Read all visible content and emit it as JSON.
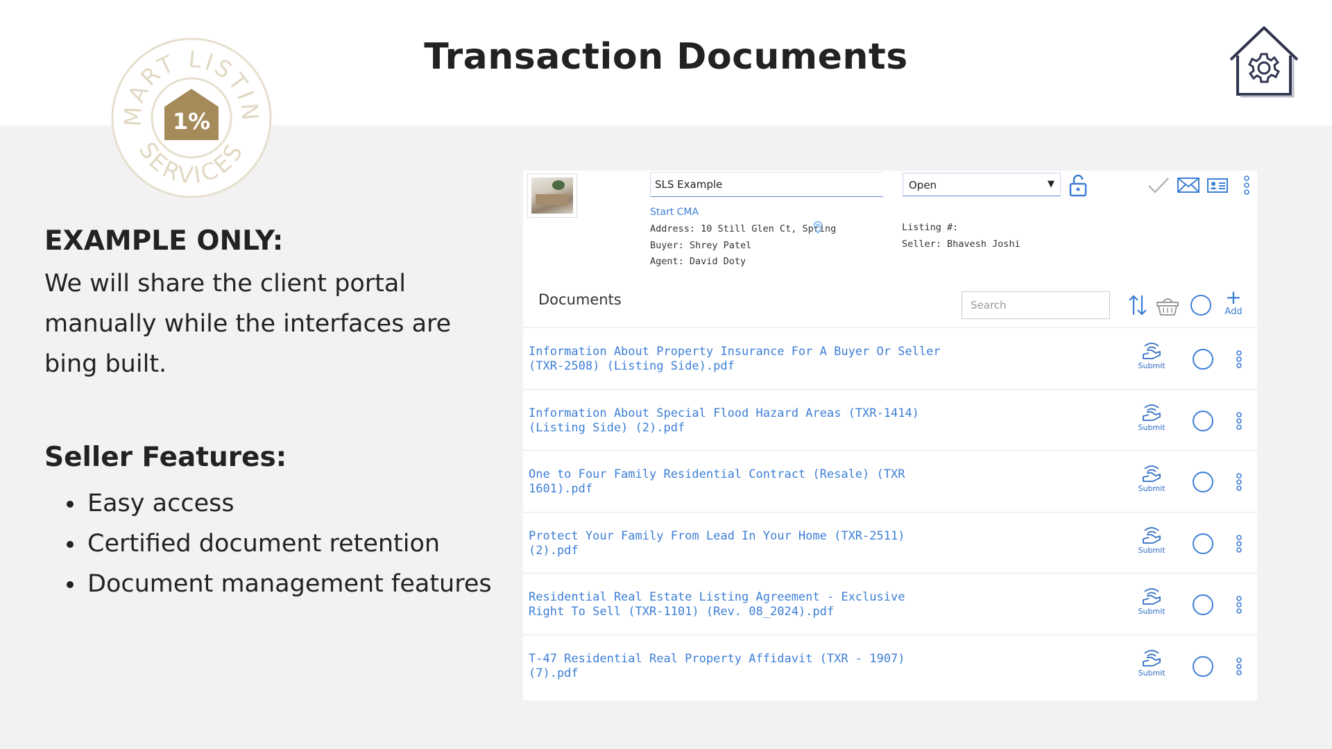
{
  "header": {
    "title": "Transaction Documents"
  },
  "logo": {
    "top_text": "SMART LISTING",
    "bottom_text": "SERVICES",
    "badge": "1%",
    "ring_color": "#e6dfcd",
    "badge_color": "#a58a5a"
  },
  "settings_icon": "house-gear-icon",
  "left": {
    "example_heading": "EXAMPLE ONLY:",
    "example_body": "We will share the client portal manually while the interfaces are bing built.",
    "features_heading": "Seller Features:",
    "features": [
      "Easy access",
      "Certified document retention",
      "Document management features"
    ]
  },
  "transaction": {
    "name_value": "SLS Example",
    "status_value": "Open",
    "start_cma": "Start CMA",
    "address": "Address: 10 Still Glen Ct, Spring",
    "buyer": "Buyer: Shrey Patel",
    "agent": "Agent: David Doty",
    "listing": "Listing #:",
    "seller": "Seller: Bhavesh Joshi"
  },
  "documents": {
    "title": "Documents",
    "search_placeholder": "Search",
    "add_label": "Add",
    "submit_label": "Submit",
    "accent": "#3b7ed6",
    "items": [
      {
        "name": "Information About Property Insurance For A Buyer Or Seller (TXR-2508) (Listing Side).pdf"
      },
      {
        "name": "Information About Special Flood Hazard Areas (TXR-1414) (Listing Side) (2).pdf"
      },
      {
        "name": "One to Four Family Residential Contract (Resale) (TXR 1601).pdf"
      },
      {
        "name": "Protect Your Family From Lead In Your Home (TXR-2511) (2).pdf"
      },
      {
        "name": "Residential Real Estate Listing Agreement - Exclusive Right To Sell (TXR-1101) (Rev. 08_2024).pdf"
      },
      {
        "name": "T-47 Residential Real Property Affidavit (TXR - 1907) (7).pdf"
      }
    ]
  }
}
